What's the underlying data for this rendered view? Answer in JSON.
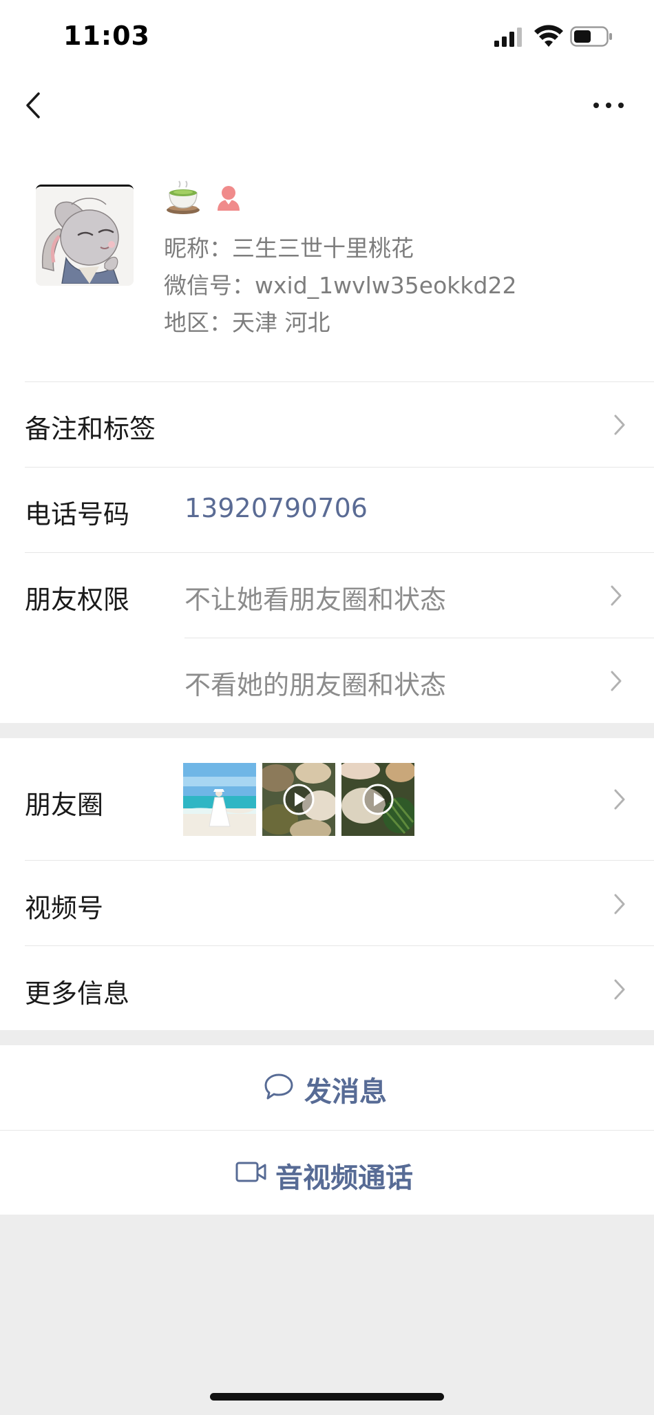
{
  "status_bar": {
    "time": "11:03",
    "icons": [
      "cellular-signal-icon",
      "wifi-icon",
      "battery-icon"
    ]
  },
  "nav": {
    "back_icon": "chevron-left-icon",
    "more_icon": "more-dots-icon"
  },
  "profile": {
    "avatar_icon": "bunny-avatar",
    "badges": [
      "tea-cup-icon",
      "female-icon"
    ],
    "nickname": "昵称：三生三世十里桃花",
    "wechat_id": "微信号：wxid_1wvlw35eokkd22",
    "region": "地区：天津 河北"
  },
  "rows": {
    "remarks_tags": "备注和标签",
    "phone_label": "电话号码",
    "phone_value": "13920790706",
    "permissions_label": "朋友权限",
    "permission_1": "不让她看朋友圈和状态",
    "permission_2": "不看她的朋友圈和状态",
    "moments_label": "朋友圈",
    "channels_label": "视频号",
    "more_info_label": "更多信息"
  },
  "actions": {
    "send_message": "发消息",
    "video_call": "音视频通话"
  },
  "colors": {
    "link_blue": "#576b95",
    "page_bg": "#ededed",
    "secondary_text": "#8c8c8c"
  }
}
